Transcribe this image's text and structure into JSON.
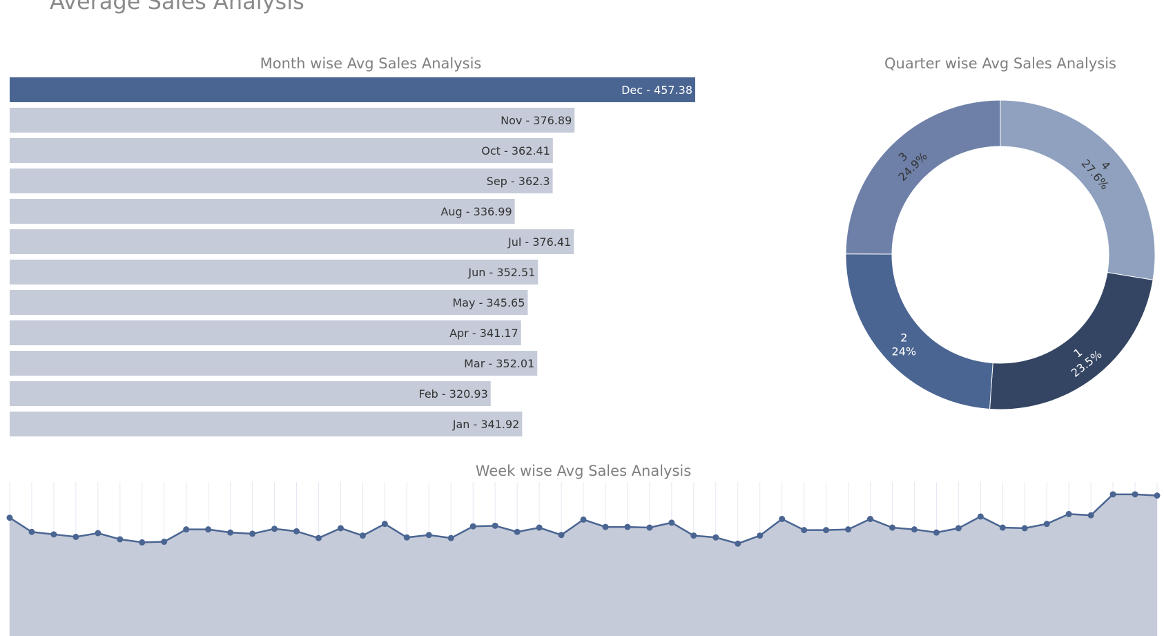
{
  "page": {
    "title": "Average Sales Analysis"
  },
  "colors": {
    "accent": "#4a6592",
    "bar_muted": "#c5cbd8",
    "line": "#4a6592",
    "area_fill": "#c5cbd8",
    "grid": "#e4e8f1",
    "label_dark": "#333333",
    "label_light": "#ffffff",
    "title": "#7f7f7f"
  },
  "chart_data": [
    {
      "type": "bar",
      "orientation": "horizontal",
      "title": "Month wise Avg Sales Analysis",
      "categories": [
        "Dec",
        "Nov",
        "Oct",
        "Sep",
        "Aug",
        "Jul",
        "Jun",
        "May",
        "Apr",
        "Mar",
        "Feb",
        "Jan"
      ],
      "values": [
        457.38,
        376.89,
        362.41,
        362.3,
        336.99,
        376.41,
        352.51,
        345.65,
        341.17,
        352.01,
        320.93,
        341.92
      ],
      "labels": [
        "Dec - 457.38",
        "Nov - 376.89",
        "Oct - 362.41",
        "Sep - 362.3",
        "Aug - 336.99",
        "Jul - 376.41",
        "Jun - 352.51",
        "May - 345.65",
        "Apr - 341.17",
        "Mar - 352.01",
        "Feb - 320.93",
        "Jan - 341.92"
      ],
      "highlight": "Dec",
      "xlim": [
        0,
        457.38
      ],
      "grid": false
    },
    {
      "type": "pie",
      "hole": true,
      "title": "Quarter wise Avg Sales Analysis",
      "slices": [
        {
          "label": "4",
          "percent": 27.6,
          "percent_text": "27.6%",
          "color": "#8fa1be"
        },
        {
          "label": "1",
          "percent": 23.5,
          "percent_text": "23.5%",
          "color": "#344563"
        },
        {
          "label": "2",
          "percent": 24.0,
          "percent_text": "24%",
          "color": "#4a6592"
        },
        {
          "label": "3",
          "percent": 24.9,
          "percent_text": "24.9%",
          "color": "#6e80a8"
        }
      ]
    },
    {
      "type": "area",
      "title": "Week wise Avg Sales Analysis",
      "x": [
        1,
        2,
        3,
        4,
        5,
        6,
        7,
        8,
        9,
        10,
        11,
        12,
        13,
        14,
        15,
        16,
        17,
        18,
        19,
        20,
        21,
        22,
        23,
        24,
        25,
        26,
        27,
        28,
        29,
        30,
        31,
        32,
        33,
        34,
        35,
        36,
        37,
        38,
        39,
        40,
        41,
        42,
        43,
        44,
        45,
        46,
        47,
        48,
        49,
        50,
        51,
        52,
        53
      ],
      "values": [
        382,
        359,
        355,
        351,
        357,
        347,
        342,
        343,
        363,
        363,
        358,
        356,
        364,
        360,
        349,
        365,
        353,
        372,
        350,
        354,
        349,
        368,
        369,
        359,
        366,
        354,
        379,
        367,
        367,
        366,
        374,
        353,
        350,
        340,
        353,
        380,
        362,
        362,
        363,
        380,
        366,
        363,
        358,
        365,
        384,
        366,
        365,
        372,
        388,
        386,
        420,
        420,
        418
      ],
      "ylim": [
        190,
        440
      ],
      "grid": "vertical"
    }
  ]
}
